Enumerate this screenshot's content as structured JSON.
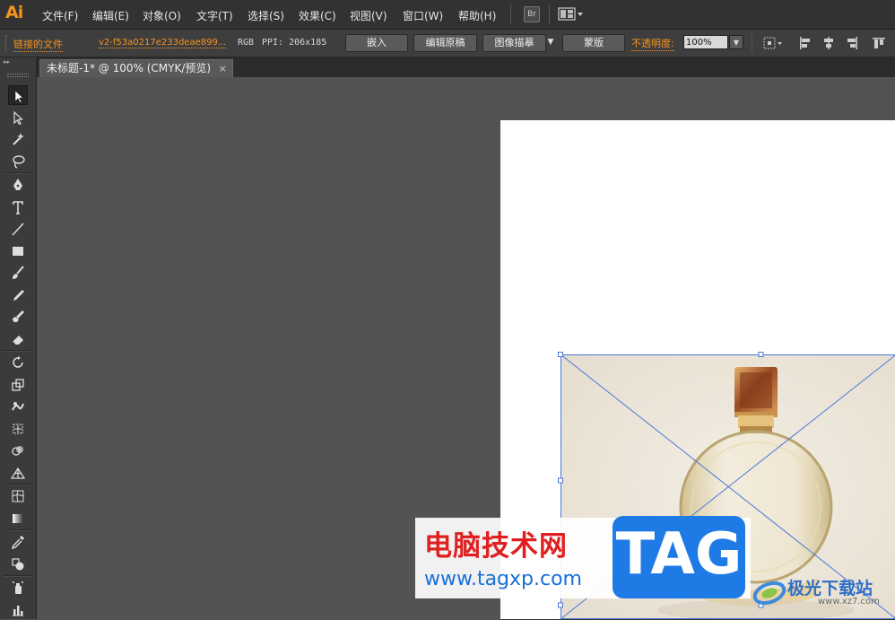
{
  "app": {
    "logo": "Ai"
  },
  "menu": [
    "文件(F)",
    "编辑(E)",
    "对象(O)",
    "文字(T)",
    "选择(S)",
    "效果(C)",
    "视图(V)",
    "窗口(W)",
    "帮助(H)"
  ],
  "menubar_buttons": {
    "bridge": "Br"
  },
  "control_bar": {
    "linked_file_label": "链接的文件",
    "file_name": "v2-f53a0217e233deae899...",
    "color_mode": "RGB",
    "ppi": "PPI: 206x185",
    "embed": "嵌入",
    "edit_original": "编辑原稿",
    "image_trace": "图像描摹",
    "mask": "蒙版",
    "opacity_label": "不透明度:",
    "opacity_value": "100%"
  },
  "document_tab": {
    "title": "未标题-1* @ 100% (CMYK/预览)",
    "close": "×"
  },
  "tools": [
    "selection-tool",
    "direct-selection-tool",
    "magic-wand-tool",
    "lasso-tool",
    "pen-tool",
    "type-tool",
    "line-segment-tool",
    "rectangle-tool",
    "paintbrush-tool",
    "pencil-tool",
    "blob-brush-tool",
    "eraser-tool",
    "rotate-tool",
    "scale-tool",
    "warp-tool",
    "free-transform-tool",
    "shape-builder-tool",
    "perspective-grid-tool",
    "mesh-tool",
    "gradient-tool",
    "eyedropper-tool",
    "blend-tool",
    "symbol-sprayer-tool",
    "column-graph-tool"
  ],
  "watermark": {
    "title": "电脑技术网",
    "url": "www.tagxp.com",
    "tag": "TAG",
    "site2_name": "极光下载站",
    "site2_url": "www.xz7.com"
  },
  "colors": {
    "accent": "#f7931e",
    "selection": "#4a78d8",
    "artboard": "#ffffff",
    "workspace": "#535353"
  }
}
